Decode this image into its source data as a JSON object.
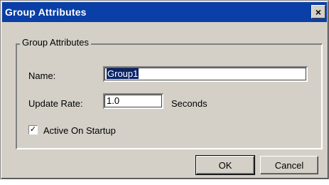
{
  "window": {
    "title": "Group Attributes",
    "close_glyph": "×"
  },
  "group": {
    "legend": "Group Attributes",
    "name_label": "Name:",
    "name_value": "Group1",
    "update_rate_label": "Update Rate:",
    "update_rate_value": "1.0",
    "update_rate_unit": "Seconds",
    "active_on_startup_label": "Active On Startup",
    "active_on_startup_checked": true,
    "checkbox_glyph": "✓"
  },
  "buttons": {
    "ok": "OK",
    "cancel": "Cancel"
  },
  "colors": {
    "titlebar": "#0a3fa7",
    "dialog_face": "#d4d0c8",
    "selection": "#0a246a"
  }
}
